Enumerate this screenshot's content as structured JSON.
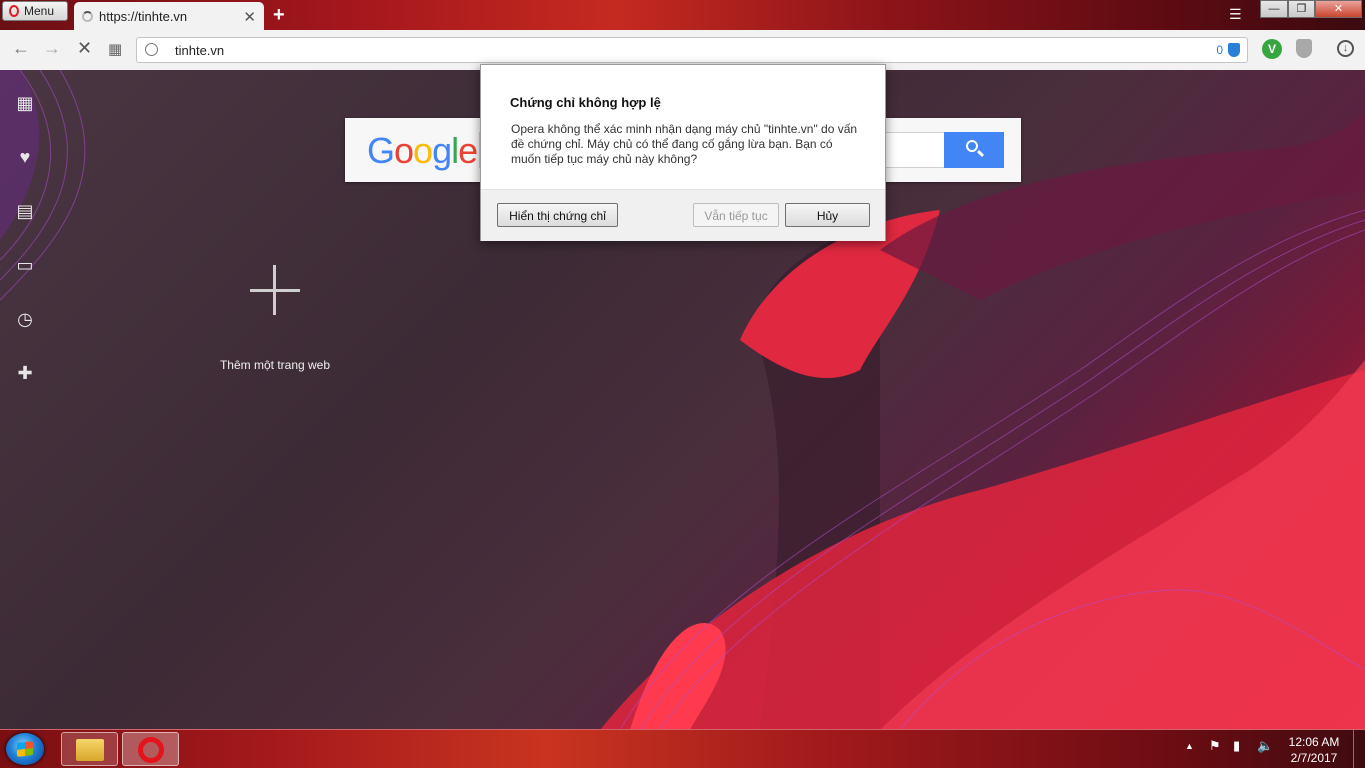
{
  "browser": {
    "menu_label": "Menu",
    "tab_title": "https://tinhte.vn",
    "tab_close": "✕",
    "new_tab": "+",
    "window_minimize": "—",
    "window_restore": "❐",
    "window_close": "✕"
  },
  "address_bar": {
    "url": "tinhte.vn",
    "blocked_count": "0"
  },
  "sidebar": {
    "items": [
      {
        "icon": "speed-dial-grid-icon",
        "glyph": "▦"
      },
      {
        "icon": "heart-icon",
        "glyph": "♥"
      },
      {
        "icon": "news-icon",
        "glyph": "▤"
      },
      {
        "icon": "devices-icon",
        "glyph": "▭"
      },
      {
        "icon": "history-clock-icon",
        "glyph": "◷"
      },
      {
        "icon": "extensions-puzzle-icon",
        "glyph": "✚"
      }
    ]
  },
  "search": {
    "logo_letters": [
      {
        "ch": "G",
        "color": "#4285f4"
      },
      {
        "ch": "o",
        "color": "#ea4335"
      },
      {
        "ch": "o",
        "color": "#fbbc05"
      },
      {
        "ch": "g",
        "color": "#4285f4"
      },
      {
        "ch": "l",
        "color": "#34a853"
      },
      {
        "ch": "e",
        "color": "#ea4335"
      }
    ],
    "button_color": "#4285f4"
  },
  "speed_dial": {
    "add_label": "Thêm một trang web"
  },
  "dialog": {
    "title": "Chứng chỉ không hợp lệ",
    "message": "Opera không thể xác minh nhận dạng máy chủ \"tinhte.vn\" do vấn đề chứng chỉ. Máy chủ có thể đang cố gắng lừa bạn. Bạn có muốn tiếp tục máy chủ này không?",
    "show_certificate": "Hiển thị chứng chỉ",
    "continue": "Vẫn tiếp tục",
    "cancel": "Hủy"
  },
  "taskbar": {
    "time": "12:06 AM",
    "date": "2/7/2017"
  }
}
